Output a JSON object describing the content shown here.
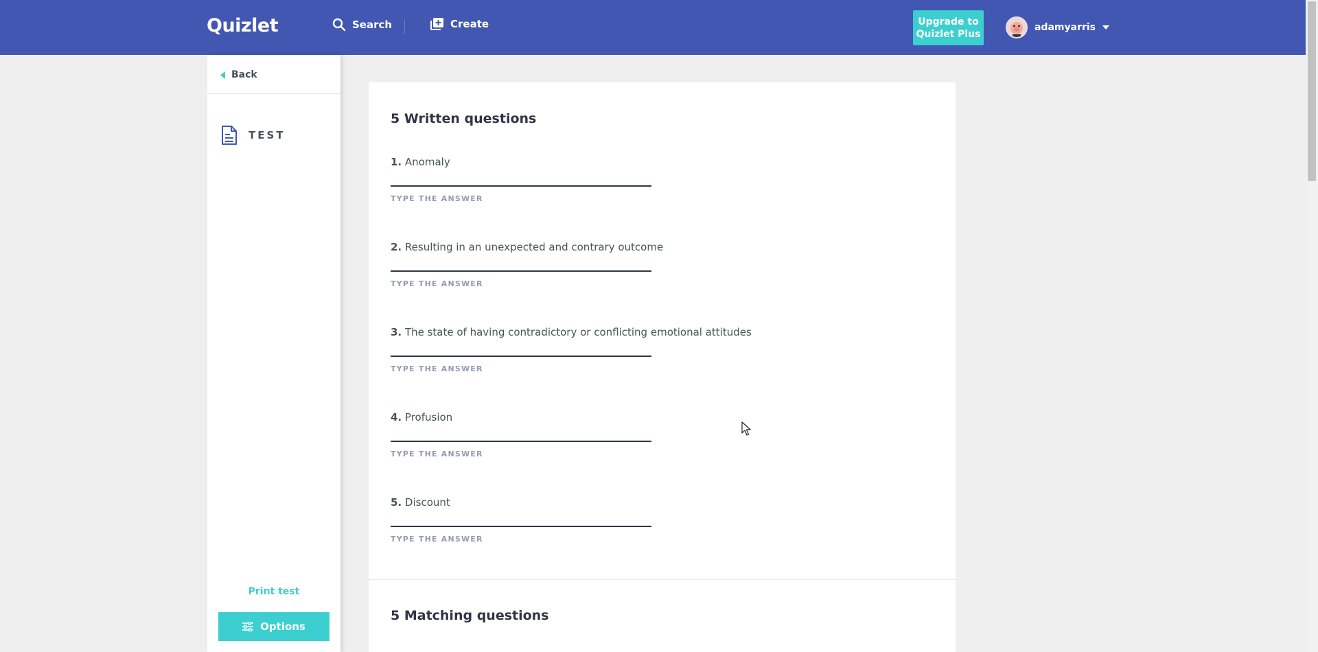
{
  "header": {
    "logo": "Quizlet",
    "search_label": "Search",
    "create_label": "Create",
    "upgrade_line1": "Upgrade to",
    "upgrade_line2": "Quizlet Plus",
    "username": "adamyarris"
  },
  "sidebar": {
    "back_label": "Back",
    "mode_label": "TEST",
    "print_label": "Print test",
    "options_label": "Options"
  },
  "written": {
    "title": "5 Written questions",
    "hint": "TYPE THE ANSWER",
    "questions": [
      {
        "num": "1.",
        "text": "Anomaly"
      },
      {
        "num": "2.",
        "text": "Resulting in an unexpected and contrary outcome"
      },
      {
        "num": "3.",
        "text": "The state of having contradictory or conflicting emotional attitudes"
      },
      {
        "num": "4.",
        "text": "Profusion"
      },
      {
        "num": "5.",
        "text": "Discount"
      }
    ]
  },
  "matching": {
    "title": "5 Matching questions"
  },
  "colors": {
    "header_bg": "#4257b2",
    "accent": "#3ccfcf",
    "text": "#455358",
    "hint": "#939bb4"
  }
}
